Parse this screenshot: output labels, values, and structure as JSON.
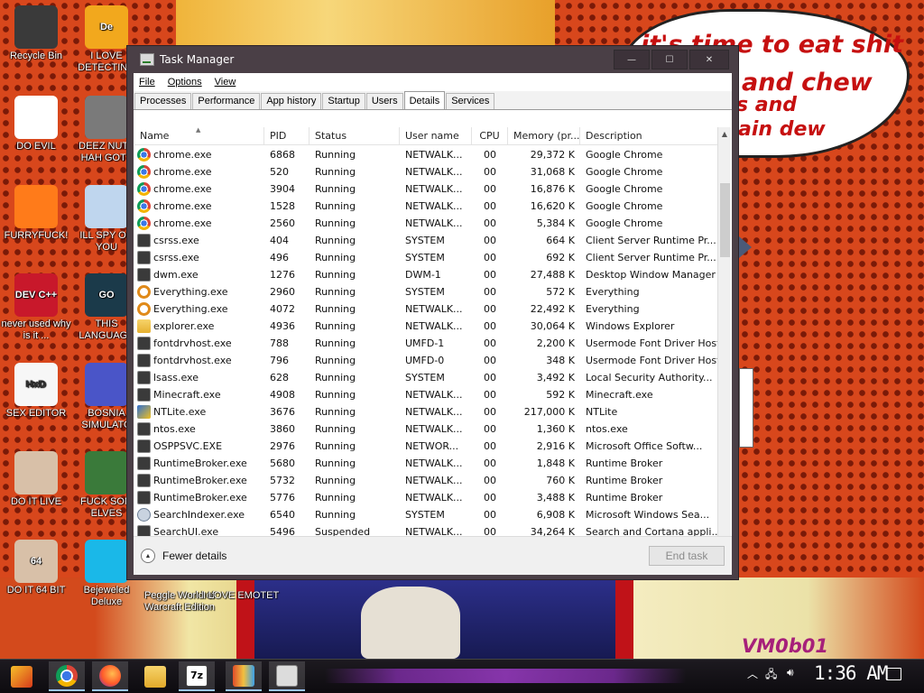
{
  "wallpaper": {
    "speech_lines": [
      "it's time to eat shit",
      "and chew",
      "s and",
      "ain dew"
    ],
    "watermark": "VM0b01"
  },
  "desktop_icons": [
    {
      "label": "Recycle Bin",
      "glyph": "",
      "color": "#3a3a3a"
    },
    {
      "label": "I LOVE DETECTING",
      "glyph": "De",
      "color": "#f2a81d"
    },
    {
      "label": "DO EVIL",
      "glyph": "",
      "color": "#ffffff"
    },
    {
      "label": "DEEZ NUTZ HAH GOTT",
      "glyph": "",
      "color": "#7a7a7a"
    },
    {
      "label": "FURRYFUCK!",
      "glyph": "",
      "color": "#ff7b1a"
    },
    {
      "label": "ILL SPY ON YOU",
      "glyph": "",
      "color": "#bfd6ee"
    },
    {
      "label": "never used why is it ...",
      "glyph": "DEV C++",
      "color": "#c8182b"
    },
    {
      "label": "THIS LANGUAGE",
      "glyph": "GO",
      "color": "#1b3a4a"
    },
    {
      "label": "SEX EDITOR",
      "glyph": "HxD",
      "color": "#f7f7f7"
    },
    {
      "label": "BOSNIA SIMULATO",
      "glyph": "",
      "color": "#4a55c8"
    },
    {
      "label": "DO IT LIVE",
      "glyph": "",
      "color": "#d8c0a8"
    },
    {
      "label": "FUCK SOM ELVES",
      "glyph": "",
      "color": "#3a7a3a"
    },
    {
      "label": "DO IT 64 BIT",
      "glyph": "64",
      "color": "#d8c0a8"
    },
    {
      "label": "Bejeweled Deluxe",
      "glyph": "",
      "color": "#1ab8e8"
    },
    {
      "label": "Peggle World of Warcraft Edition",
      "glyph": "",
      "color": ""
    },
    {
      "label": "I LOVE EMOTET",
      "glyph": "",
      "color": ""
    }
  ],
  "taskmanager": {
    "title": "Task Manager",
    "controls": {
      "minimize": "—",
      "maximize": "☐",
      "close": "✕"
    },
    "menu": [
      "File",
      "Options",
      "View"
    ],
    "tabs": [
      "Processes",
      "Performance",
      "App history",
      "Startup",
      "Users",
      "Details",
      "Services"
    ],
    "active_tab": "Details",
    "columns": [
      "Name",
      "PID",
      "Status",
      "User name",
      "CPU",
      "Memory (pr...",
      "Description"
    ],
    "rows": [
      {
        "icon": "chrome",
        "name": "chrome.exe",
        "pid": "6868",
        "status": "Running",
        "user": "NETWALK...",
        "cpu": "00",
        "mem": "29,372 K",
        "desc": "Google Chrome"
      },
      {
        "icon": "chrome",
        "name": "chrome.exe",
        "pid": "520",
        "status": "Running",
        "user": "NETWALK...",
        "cpu": "00",
        "mem": "31,068 K",
        "desc": "Google Chrome"
      },
      {
        "icon": "chrome",
        "name": "chrome.exe",
        "pid": "3904",
        "status": "Running",
        "user": "NETWALK...",
        "cpu": "00",
        "mem": "16,876 K",
        "desc": "Google Chrome"
      },
      {
        "icon": "chrome",
        "name": "chrome.exe",
        "pid": "1528",
        "status": "Running",
        "user": "NETWALK...",
        "cpu": "00",
        "mem": "16,620 K",
        "desc": "Google Chrome"
      },
      {
        "icon": "chrome",
        "name": "chrome.exe",
        "pid": "2560",
        "status": "Running",
        "user": "NETWALK...",
        "cpu": "00",
        "mem": "5,384 K",
        "desc": "Google Chrome"
      },
      {
        "icon": "sys",
        "name": "csrss.exe",
        "pid": "404",
        "status": "Running",
        "user": "SYSTEM",
        "cpu": "00",
        "mem": "664 K",
        "desc": "Client Server Runtime Pr..."
      },
      {
        "icon": "sys",
        "name": "csrss.exe",
        "pid": "496",
        "status": "Running",
        "user": "SYSTEM",
        "cpu": "00",
        "mem": "692 K",
        "desc": "Client Server Runtime Pr..."
      },
      {
        "icon": "sys",
        "name": "dwm.exe",
        "pid": "1276",
        "status": "Running",
        "user": "DWM-1",
        "cpu": "00",
        "mem": "27,488 K",
        "desc": "Desktop Window Manager"
      },
      {
        "icon": "search",
        "name": "Everything.exe",
        "pid": "2960",
        "status": "Running",
        "user": "SYSTEM",
        "cpu": "00",
        "mem": "572 K",
        "desc": "Everything"
      },
      {
        "icon": "search",
        "name": "Everything.exe",
        "pid": "4072",
        "status": "Running",
        "user": "NETWALK...",
        "cpu": "00",
        "mem": "22,492 K",
        "desc": "Everything"
      },
      {
        "icon": "folder",
        "name": "explorer.exe",
        "pid": "4936",
        "status": "Running",
        "user": "NETWALK...",
        "cpu": "00",
        "mem": "30,064 K",
        "desc": "Windows Explorer"
      },
      {
        "icon": "sys",
        "name": "fontdrvhost.exe",
        "pid": "788",
        "status": "Running",
        "user": "UMFD-1",
        "cpu": "00",
        "mem": "2,200 K",
        "desc": "Usermode Font Driver Host"
      },
      {
        "icon": "sys",
        "name": "fontdrvhost.exe",
        "pid": "796",
        "status": "Running",
        "user": "UMFD-0",
        "cpu": "00",
        "mem": "348 K",
        "desc": "Usermode Font Driver Host"
      },
      {
        "icon": "sys",
        "name": "lsass.exe",
        "pid": "628",
        "status": "Running",
        "user": "SYSTEM",
        "cpu": "00",
        "mem": "3,492 K",
        "desc": "Local Security Authority..."
      },
      {
        "icon": "sys",
        "name": "Minecraft.exe",
        "pid": "4908",
        "status": "Running",
        "user": "NETWALK...",
        "cpu": "00",
        "mem": "592 K",
        "desc": "Minecraft.exe"
      },
      {
        "icon": "ntlite",
        "name": "NTLite.exe",
        "pid": "3676",
        "status": "Running",
        "user": "NETWALK...",
        "cpu": "00",
        "mem": "217,000 K",
        "desc": "NTLite"
      },
      {
        "icon": "sys",
        "name": "ntos.exe",
        "pid": "3860",
        "status": "Running",
        "user": "NETWALK...",
        "cpu": "00",
        "mem": "1,360 K",
        "desc": "ntos.exe"
      },
      {
        "icon": "sys",
        "name": "OSPPSVC.EXE",
        "pid": "2976",
        "status": "Running",
        "user": "NETWOR...",
        "cpu": "00",
        "mem": "2,916 K",
        "desc": "Microsoft Office Softw..."
      },
      {
        "icon": "sys",
        "name": "RuntimeBroker.exe",
        "pid": "5680",
        "status": "Running",
        "user": "NETWALK...",
        "cpu": "00",
        "mem": "1,848 K",
        "desc": "Runtime Broker"
      },
      {
        "icon": "sys",
        "name": "RuntimeBroker.exe",
        "pid": "5732",
        "status": "Running",
        "user": "NETWALK...",
        "cpu": "00",
        "mem": "760 K",
        "desc": "Runtime Broker"
      },
      {
        "icon": "sys",
        "name": "RuntimeBroker.exe",
        "pid": "5776",
        "status": "Running",
        "user": "NETWALK...",
        "cpu": "00",
        "mem": "3,488 K",
        "desc": "Runtime Broker"
      },
      {
        "icon": "person",
        "name": "SearchIndexer.exe",
        "pid": "6540",
        "status": "Running",
        "user": "SYSTEM",
        "cpu": "00",
        "mem": "6,908 K",
        "desc": "Microsoft Windows Sea..."
      },
      {
        "icon": "sys",
        "name": "SearchUI.exe",
        "pid": "5496",
        "status": "Suspended",
        "user": "NETWALK...",
        "cpu": "00",
        "mem": "34,264 K",
        "desc": "Search and Cortana appli..."
      }
    ],
    "footer": {
      "fewer_details": "Fewer details",
      "end_task": "End task"
    }
  },
  "taskbar": {
    "items": [
      "start-icon",
      "chrome-icon",
      "firefox-icon",
      "file-explorer-icon",
      "7zip-icon",
      "app-icon",
      "task-manager-icon"
    ],
    "seven_zip_label": "7z",
    "clock": "1:36 AM"
  }
}
